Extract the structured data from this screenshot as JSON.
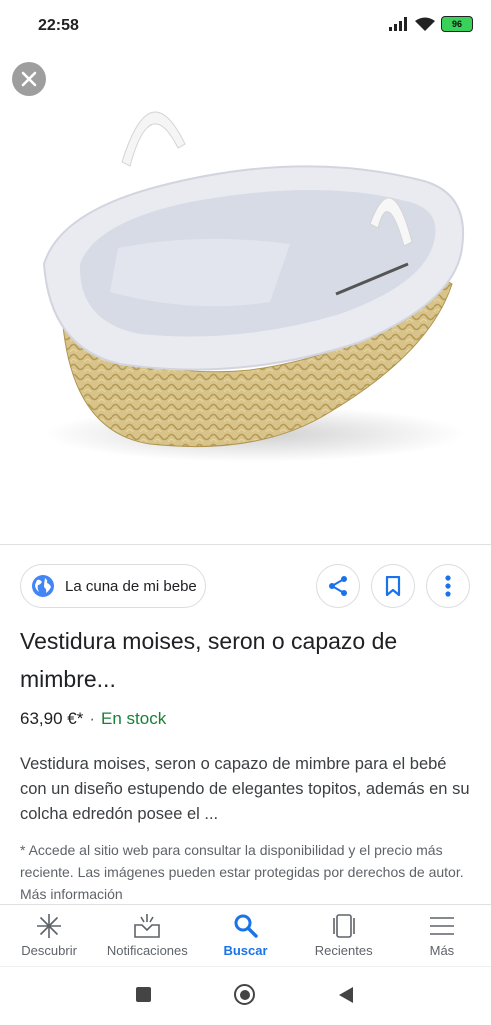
{
  "status": {
    "time": "22:58",
    "battery": "96"
  },
  "product": {
    "source": "La cuna de mi bebe",
    "title": "Vestidura moises, seron o capazo de mimbre...",
    "price": "63,90 €*",
    "separator": "·",
    "availability": "En stock",
    "description": "Vestidura moises, seron o capazo de mimbre para el bebé con un diseño estupendo de elegantes topitos, además en su colcha edredón posee el ...",
    "note": "* Accede al sitio web para consultar la disponibilidad y el precio más reciente. Las imágenes pueden estar protegidas por derechos de autor. Más información"
  },
  "bottom_nav": {
    "items": [
      {
        "label": "Descubrir",
        "icon": "asterisk-icon"
      },
      {
        "label": "Notificaciones",
        "icon": "inbox-icon"
      },
      {
        "label": "Buscar",
        "icon": "search-icon",
        "active": true
      },
      {
        "label": "Recientes",
        "icon": "tabs-icon"
      },
      {
        "label": "Más",
        "icon": "menu-icon"
      }
    ]
  },
  "colors": {
    "accent": "#1a73e8",
    "stock_green": "#188038"
  }
}
